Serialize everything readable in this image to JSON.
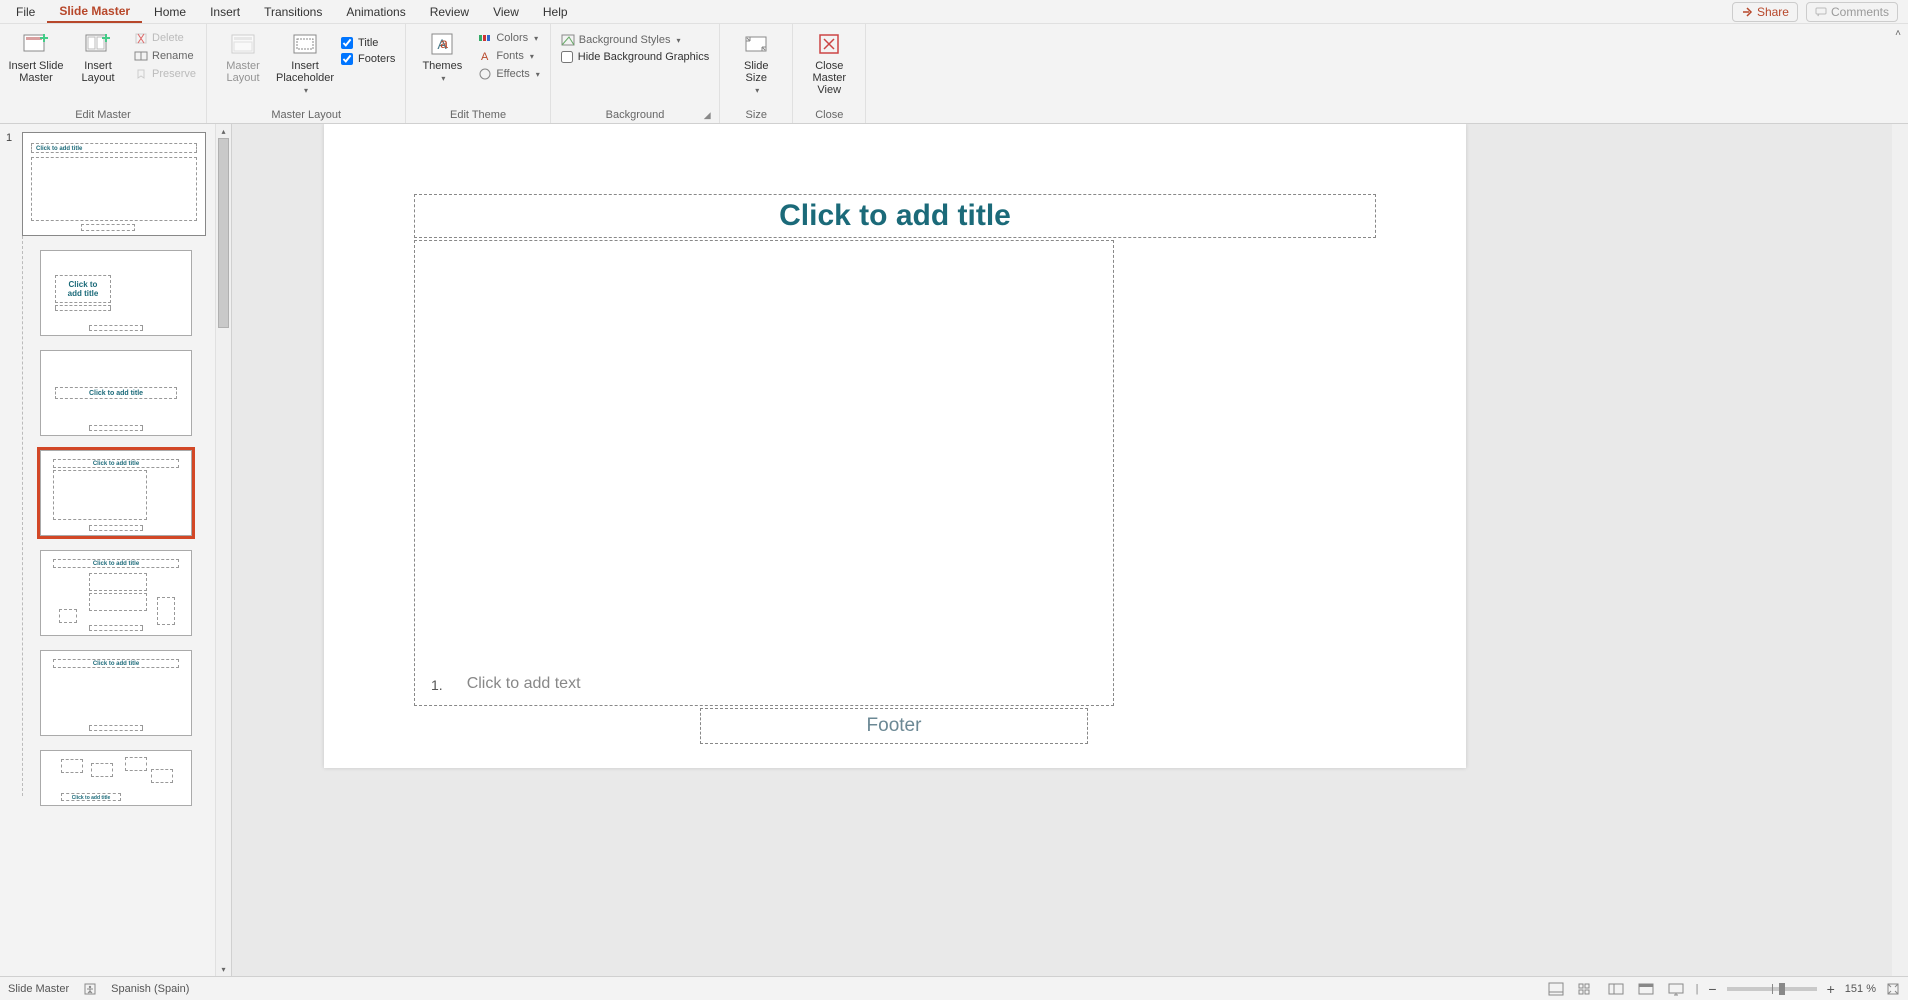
{
  "tabs": {
    "file": "File",
    "slide_master": "Slide Master",
    "home": "Home",
    "insert": "Insert",
    "transitions": "Transitions",
    "animations": "Animations",
    "review": "Review",
    "view": "View",
    "help": "Help"
  },
  "topright": {
    "share": "Share",
    "comments": "Comments"
  },
  "ribbon": {
    "edit_master": {
      "insert_slide_master": "Insert Slide\nMaster",
      "insert_layout": "Insert\nLayout",
      "delete": "Delete",
      "rename": "Rename",
      "preserve": "Preserve",
      "label": "Edit Master"
    },
    "master_layout": {
      "master_layout": "Master\nLayout",
      "insert_placeholder": "Insert\nPlaceholder",
      "title": "Title",
      "footers": "Footers",
      "label": "Master Layout"
    },
    "edit_theme": {
      "themes": "Themes",
      "colors": "Colors",
      "fonts": "Fonts",
      "effects": "Effects",
      "label": "Edit Theme"
    },
    "background": {
      "bg_styles": "Background Styles",
      "hide_bg": "Hide Background Graphics",
      "label": "Background"
    },
    "size": {
      "slide_size": "Slide\nSize",
      "label": "Size"
    },
    "close": {
      "close_master": "Close\nMaster View",
      "label": "Close"
    }
  },
  "side": {
    "master_index": "1"
  },
  "slide": {
    "title_placeholder": "Click to add title",
    "text_number": "1.",
    "text_placeholder": "Click to add text",
    "footer": "Footer"
  },
  "status": {
    "view_mode": "Slide Master",
    "language": "Spanish (Spain)",
    "zoom": "151 %"
  }
}
